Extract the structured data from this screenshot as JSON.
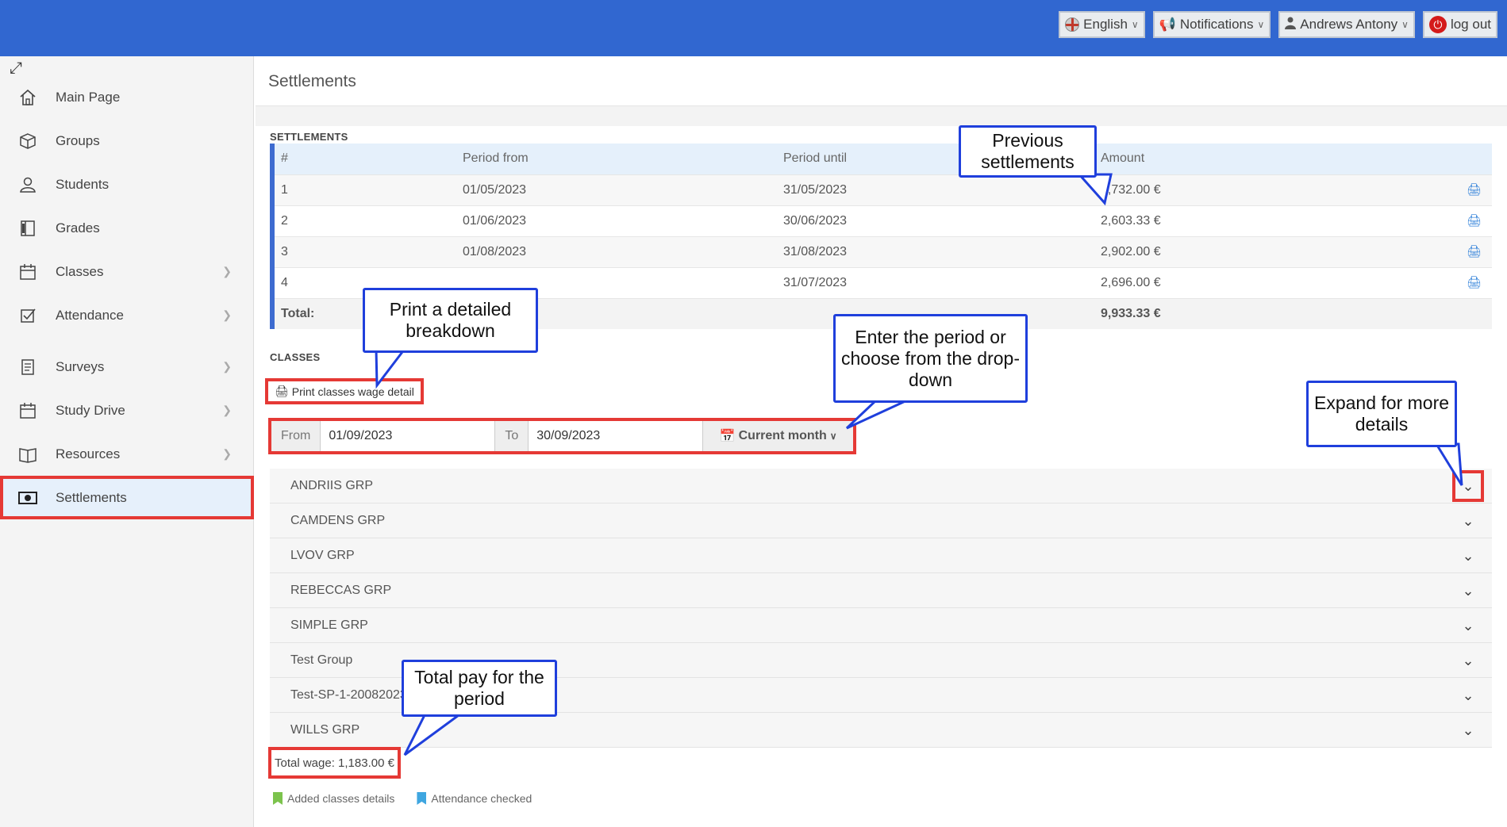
{
  "topbar": {
    "language": "English",
    "notifications": "Notifications",
    "user": "Andrews Antony",
    "logout": "log out"
  },
  "sidebar": {
    "items": [
      {
        "label": "Main Page",
        "icon": "home-icon",
        "has_arrow": false
      },
      {
        "label": "Groups",
        "icon": "cube-icon",
        "has_arrow": false
      },
      {
        "label": "Students",
        "icon": "user-icon",
        "has_arrow": false
      },
      {
        "label": "Grades",
        "icon": "gradebook-icon",
        "has_arrow": false
      },
      {
        "label": "Classes",
        "icon": "calendar-icon",
        "has_arrow": true
      },
      {
        "label": "Attendance",
        "icon": "checkbox-icon",
        "has_arrow": true
      },
      {
        "label": "Surveys",
        "icon": "clipboard-icon",
        "has_arrow": true
      },
      {
        "label": "Study Drive",
        "icon": "calendar-icon",
        "has_arrow": true
      },
      {
        "label": "Resources",
        "icon": "book-icon",
        "has_arrow": true
      },
      {
        "label": "Settlements",
        "icon": "money-icon",
        "has_arrow": false,
        "active": true
      }
    ]
  },
  "page": {
    "title": "Settlements"
  },
  "settlements": {
    "section_label": "SETTLEMENTS",
    "columns": [
      "#",
      "Period from",
      "Period until",
      "Amount"
    ],
    "rows": [
      {
        "n": "1",
        "from": "01/05/2023",
        "until": "31/05/2023",
        "amount": "1,732.00 €"
      },
      {
        "n": "2",
        "from": "01/06/2023",
        "until": "30/06/2023",
        "amount": "2,603.33 €"
      },
      {
        "n": "3",
        "from": "01/08/2023",
        "until": "31/08/2023",
        "amount": "2,902.00 €"
      },
      {
        "n": "4",
        "from": "",
        "until": "31/07/2023",
        "amount": "2,696.00 €"
      }
    ],
    "total_label": "Total:",
    "total_amount": "9,933.33 €"
  },
  "classes": {
    "section_label": "CLASSES",
    "print_button": "Print classes wage detail",
    "from_label": "From",
    "from_value": "01/09/2023",
    "to_label": "To",
    "to_value": "30/09/2023",
    "range_button": "Current month",
    "groups": [
      "ANDRIIS GRP",
      "CAMDENS GRP",
      "LVOV GRP",
      "REBECCAS GRP",
      "SIMPLE GRP",
      "Test Group",
      "Test-SP-1-20082023",
      "WILLS GRP"
    ],
    "total_wage": "Total wage: 1,183.00 €",
    "legend": [
      {
        "label": "Added classes details",
        "color": "#7cc34d"
      },
      {
        "label": "Attendance checked",
        "color": "#3fa6e0"
      }
    ]
  },
  "callouts": {
    "previous": "Previous settlements",
    "print": "Print a detailed breakdown",
    "period": "Enter the period or choose from the drop-down",
    "expand": "Expand for more details",
    "total": "Total pay for the period"
  }
}
